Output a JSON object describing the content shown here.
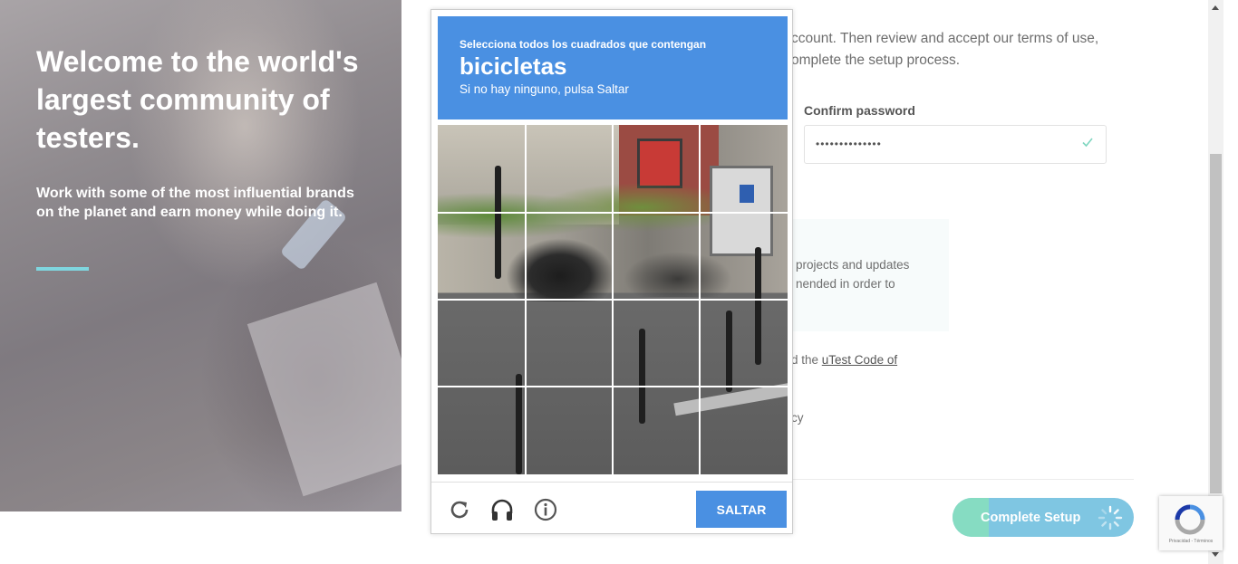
{
  "hero": {
    "headline": "Welcome to the world's largest community of testers.",
    "subtext": "Work with some of the most influential brands on the planet and earn money while doing it.",
    "accent_color": "#7fd6df"
  },
  "form": {
    "intro_line1": "ccount. Then review and accept our terms of use,",
    "intro_line2": "omplete the setup process.",
    "confirm_password_label": "Confirm password",
    "confirm_password_value": "••••••••••••••",
    "notice_line1": "projects and updates",
    "notice_line2": "nended in order to",
    "code_prefix": "d the ",
    "code_link": "uTest Code of",
    "policy_fragment": "cy",
    "complete_setup_label": "Complete Setup"
  },
  "captcha": {
    "instruction": "Selecciona todos los cuadrados que contengan",
    "target": "bicicletas",
    "hint": "Si no hay ninguno, pulsa Saltar",
    "skip_label": "SALTAR",
    "header_color": "#4a90e2",
    "icons": [
      "reload-icon",
      "audio-headphones-icon",
      "info-icon"
    ]
  },
  "badge": {
    "terms": "Privacidad - Términos"
  }
}
